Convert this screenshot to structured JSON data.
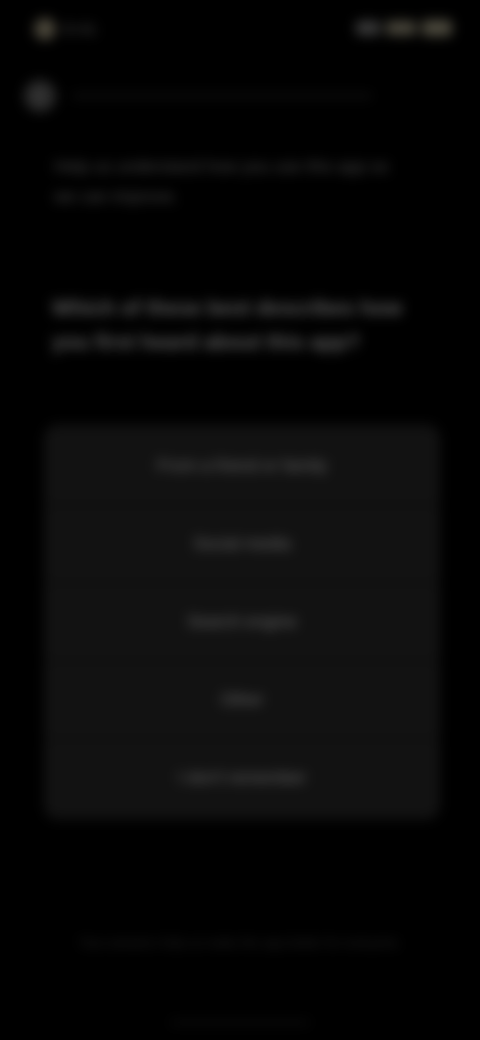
{
  "status_bar": {
    "time": "9:41"
  },
  "intro": {
    "text": "Help us understand how you use this app so we can improve."
  },
  "question": {
    "text": "Which of these best describes how you first heard about this app?"
  },
  "options": [
    {
      "label": "From a friend or family"
    },
    {
      "label": "Social media"
    },
    {
      "label": "Search engine"
    },
    {
      "label": "Other"
    },
    {
      "label": "I don't remember"
    }
  ],
  "footer": {
    "text": "Your answers help us make the app better for everyone."
  },
  "colors": {
    "background": "#000000",
    "option_bg": "#121212",
    "text": "#6a6a6a"
  }
}
